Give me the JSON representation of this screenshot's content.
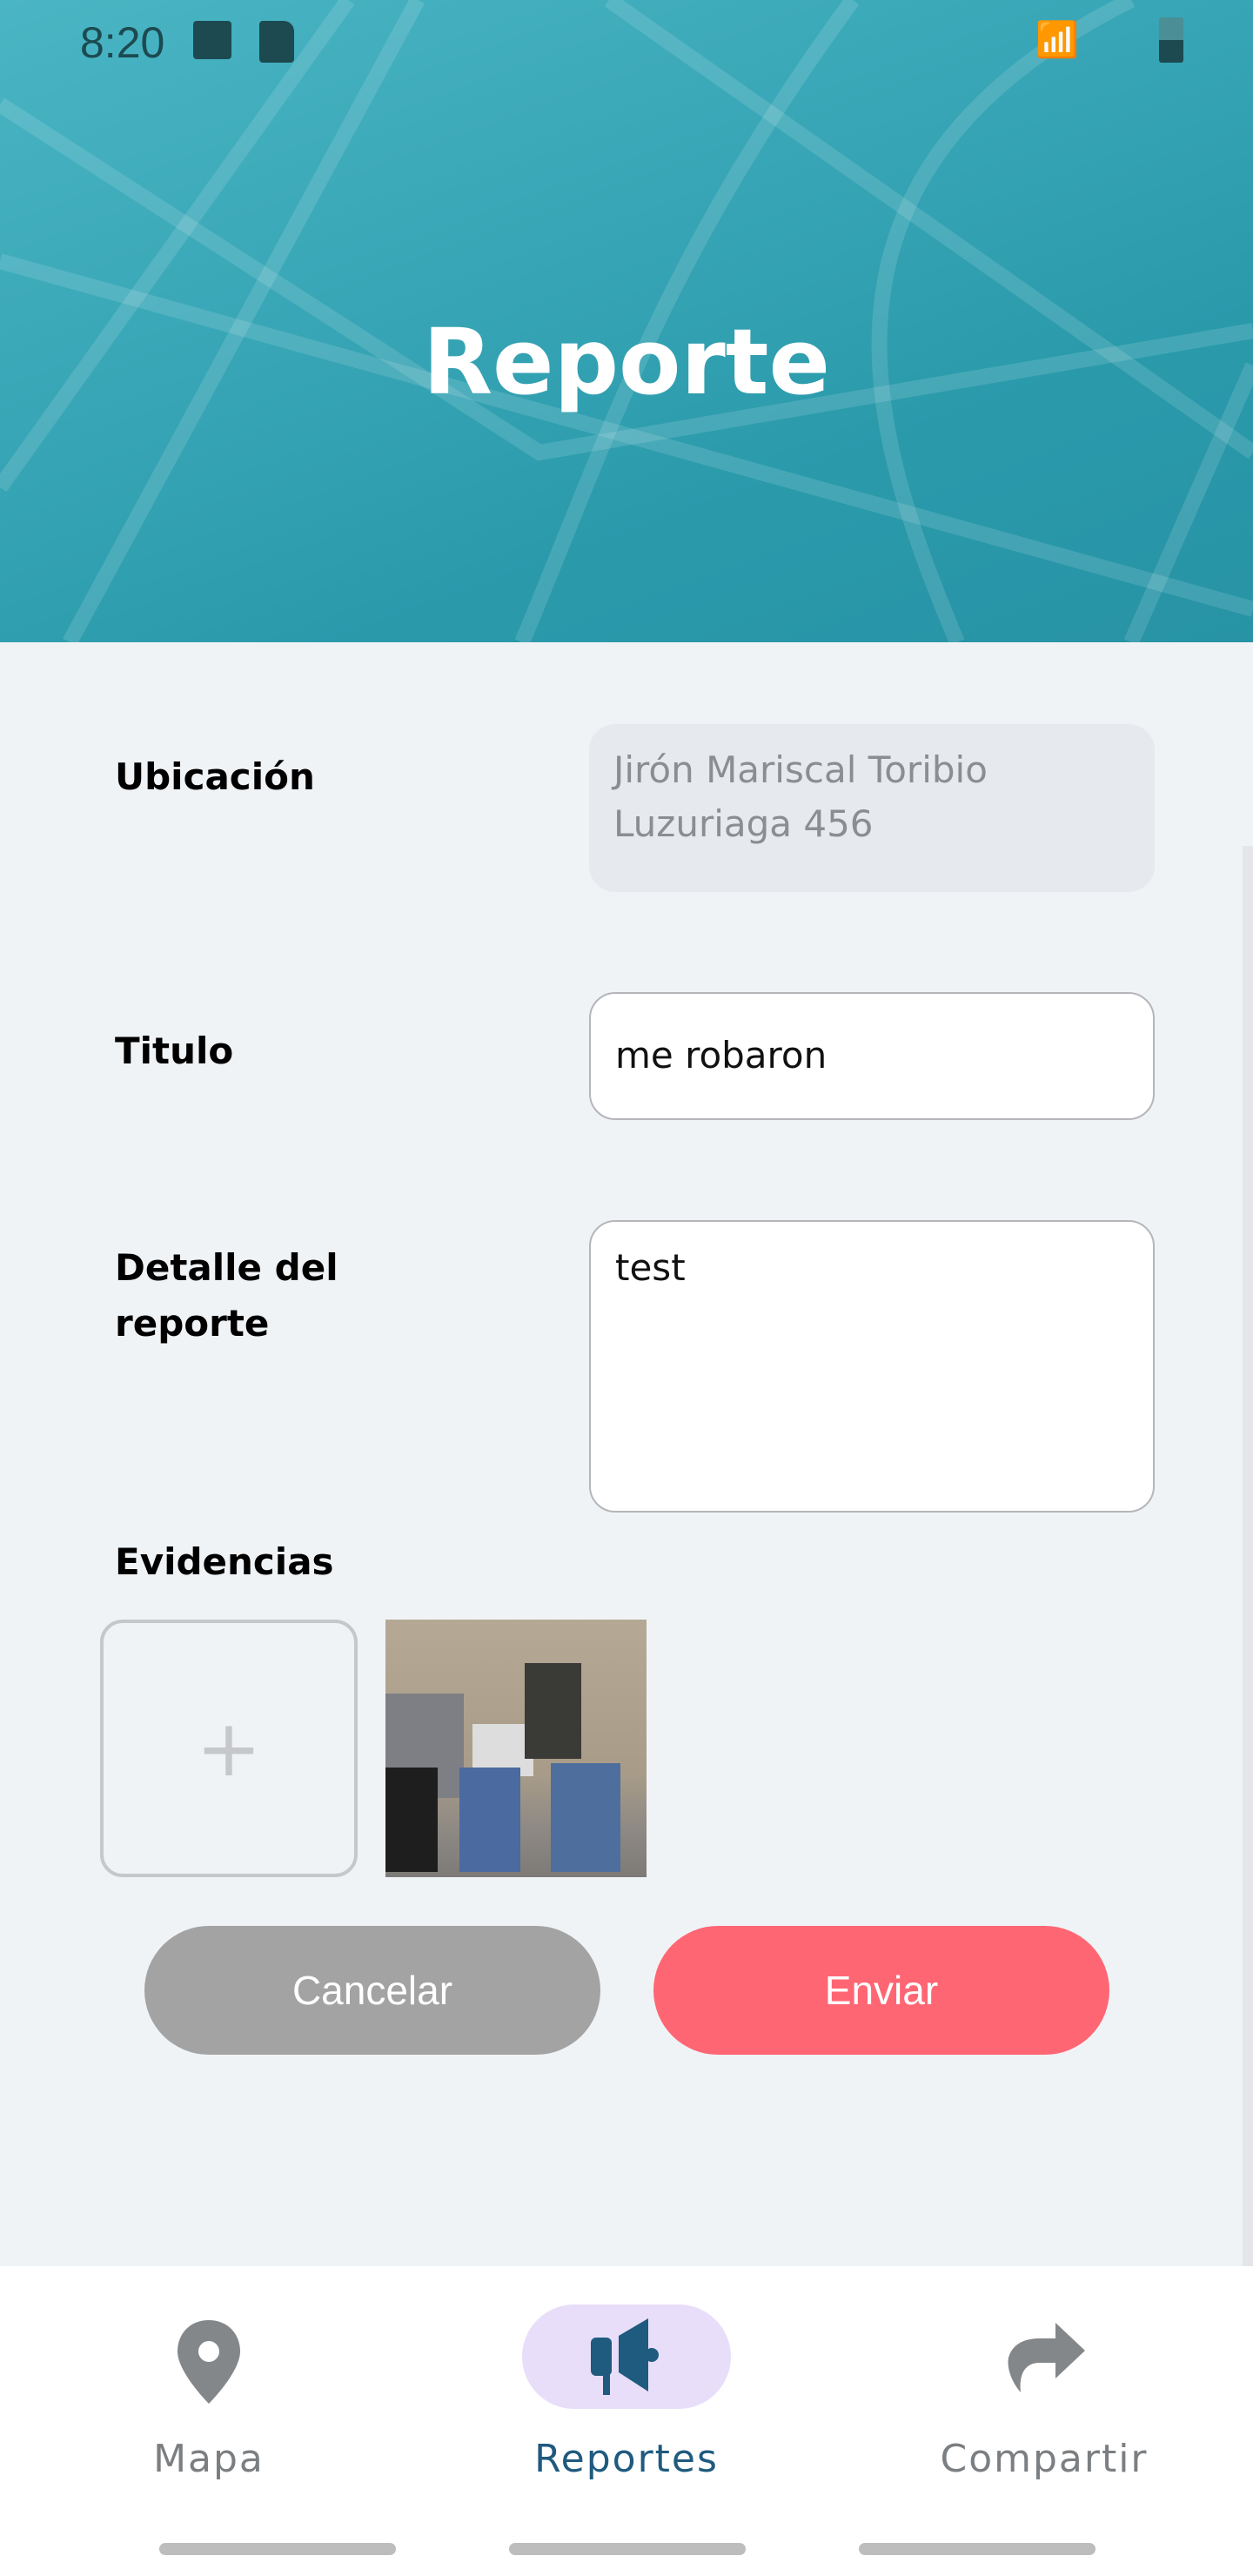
{
  "status_bar": {
    "time": "8:20"
  },
  "header": {
    "title": "Reporte"
  },
  "form": {
    "location": {
      "label": "Ubicación",
      "value": "Jirón Mariscal Toribio Luzuriaga 456"
    },
    "title": {
      "label": "Titulo",
      "value": "me robaron"
    },
    "detail": {
      "label": "Detalle del reporte",
      "value": "test"
    },
    "evidence": {
      "label": "Evidencias",
      "add": "+"
    }
  },
  "actions": {
    "cancel": "Cancelar",
    "send": "Enviar"
  },
  "colors": {
    "header": "#2fa0b1",
    "cancel": "#a3a3a3",
    "send": "#ff6673",
    "active_nav": "#1f5a7f",
    "active_pill": "#e8defa"
  },
  "nav": [
    {
      "label": "Mapa",
      "icon": "map-pin-icon"
    },
    {
      "label": "Reportes",
      "icon": "megaphone-icon",
      "active": true
    },
    {
      "label": "Compartir",
      "icon": "share-icon"
    }
  ]
}
